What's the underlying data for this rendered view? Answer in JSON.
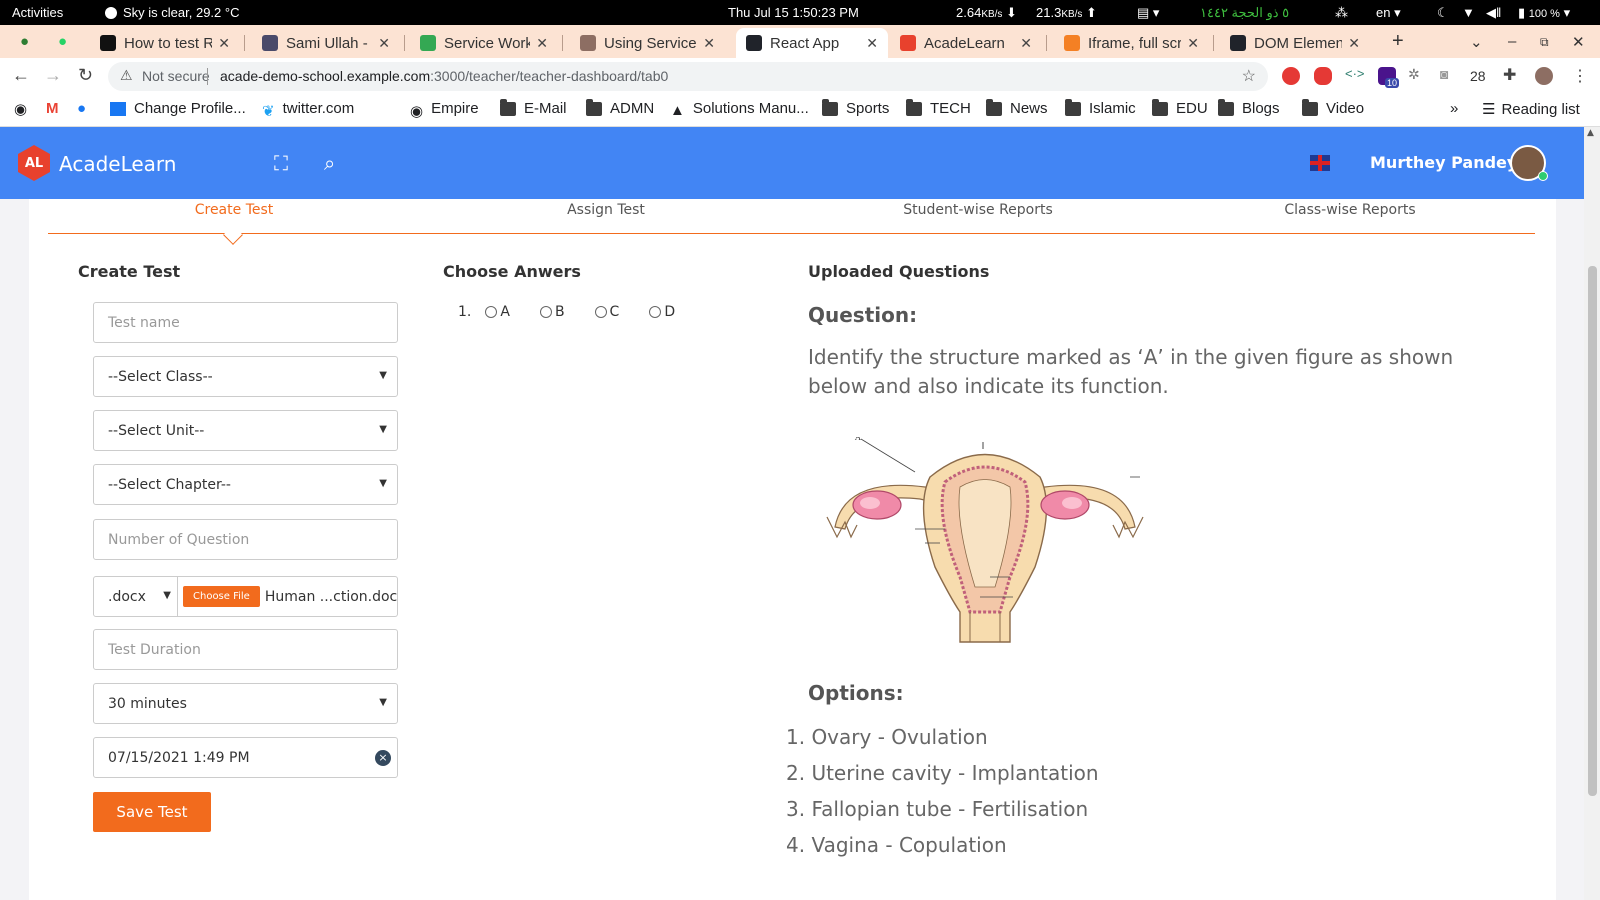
{
  "system": {
    "activities": "Activities",
    "weather": "Sky is clear, 29.2 °C",
    "datetime": "Thu Jul 15   1:50:23 PM",
    "net_down": "2.64",
    "net_down_unit": "KB/s",
    "net_up": "21.3",
    "net_up_unit": "KB/s",
    "hijri": "٥ ذو الحجة ١٤٤٢",
    "lang": "en",
    "battery": "100 %"
  },
  "tabs": [
    {
      "title": "How to test RE",
      "active": false,
      "color": "#111111"
    },
    {
      "title": "Sami Ullah - In",
      "active": false,
      "color": "#4a4a6a"
    },
    {
      "title": "Service Worke",
      "active": false,
      "color": "#34a853"
    },
    {
      "title": "Using Service",
      "active": false,
      "color": "#8d6e63"
    },
    {
      "title": "React App",
      "active": true,
      "color": "#20232a"
    },
    {
      "title": "AcadeLearn",
      "active": false,
      "color": "#e8412d"
    },
    {
      "title": "Iframe, full scr",
      "active": false,
      "color": "#f48024"
    },
    {
      "title": "DOM Element",
      "active": false,
      "color": "#20232a"
    }
  ],
  "omnibox": {
    "security": "Not secure",
    "url_host": "acade-demo-school.example.com",
    "url_path": ":3000/teacher/teacher-dashboard/tab0"
  },
  "extensions": {
    "badge_count": "28",
    "notif": "10"
  },
  "bookmarks": [
    {
      "label": "Change Profile..."
    },
    {
      "label": "twitter.com"
    },
    {
      "label": "Empire"
    },
    {
      "label": "E-Mail"
    },
    {
      "label": "ADMN"
    },
    {
      "label": "Solutions Manu..."
    },
    {
      "label": "Sports"
    },
    {
      "label": "TECH"
    },
    {
      "label": "News"
    },
    {
      "label": "Islamic"
    },
    {
      "label": "EDU"
    },
    {
      "label": "Blogs"
    },
    {
      "label": "Video"
    }
  ],
  "bookmarks_more": "»",
  "reading_list": "Reading list",
  "header": {
    "logo_text": "AL",
    "brand": "AcadeLearn",
    "user_name": "Murthey Pandey",
    "accent": "#4285f4"
  },
  "subtabs": [
    {
      "label": "Create Test",
      "active": true
    },
    {
      "label": "Assign Test",
      "active": false
    },
    {
      "label": "Student-wise Reports",
      "active": false
    },
    {
      "label": "Class-wise Reports",
      "active": false
    }
  ],
  "create_test": {
    "title": "Create Test",
    "test_name_placeholder": "Test name",
    "class_select": "--Select Class--",
    "unit_select": "--Select Unit--",
    "chapter_select": "--Select Chapter--",
    "num_questions_placeholder": "Number of Question",
    "file_type": ".docx",
    "choose_file": "Choose File",
    "file_name": "Human ...ction.docx",
    "duration_placeholder": "Test Duration",
    "duration_select": "30 minutes",
    "datetime_value": "07/15/2021 1:49 PM",
    "save_button": "Save Test"
  },
  "answers": {
    "title": "Choose Anwers",
    "question_number": "1.",
    "options": [
      "A",
      "B",
      "C",
      "D"
    ]
  },
  "uploaded": {
    "title": "Uploaded Questions",
    "question_label": "Question:",
    "question_text": "Identify the structure marked as ‘A’ in the given figure as shown below and also indicate its function.",
    "figure_marker": "A",
    "options_label": "Options:",
    "options": [
      "1. Ovary - Ovulation",
      "2. Uterine cavity - Implantation",
      "3. Fallopian tube - Fertilisation",
      "4. Vagina - Copulation"
    ]
  },
  "colors": {
    "orange": "#f26b1d",
    "header_blue": "#4285f4"
  }
}
